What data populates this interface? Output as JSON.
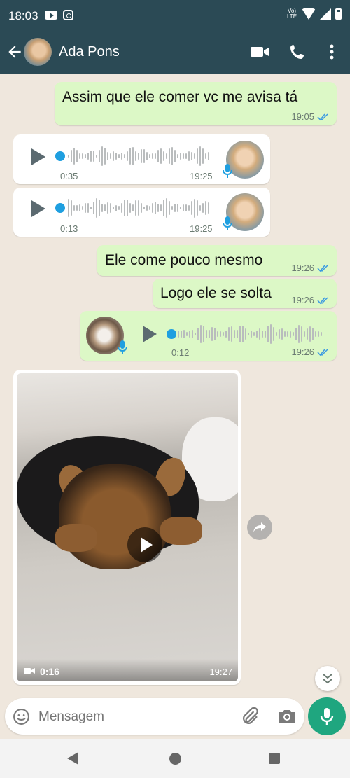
{
  "status_bar": {
    "time": "18:03",
    "network": "LTE"
  },
  "header": {
    "contact_name": "Ada Pons"
  },
  "messages": [
    {
      "type": "text",
      "direction": "out",
      "text": "Assim que ele comer vc me avisa tá",
      "time": "19:05",
      "status": "read"
    },
    {
      "type": "voice",
      "direction": "in",
      "duration": "0:35",
      "time": "19:25"
    },
    {
      "type": "voice",
      "direction": "in",
      "duration": "0:13",
      "time": "19:25"
    },
    {
      "type": "text",
      "direction": "out",
      "text": "Ele come pouco mesmo",
      "time": "19:26",
      "status": "read"
    },
    {
      "type": "text",
      "direction": "out",
      "text": "Logo ele se solta",
      "time": "19:26",
      "status": "read"
    },
    {
      "type": "voice",
      "direction": "out",
      "duration": "0:12",
      "time": "19:26",
      "status": "read"
    },
    {
      "type": "video",
      "direction": "in",
      "duration": "0:16",
      "time": "19:27"
    }
  ],
  "composer": {
    "placeholder": "Mensagem"
  },
  "colors": {
    "header": "#2b4a55",
    "outgoing_bubble": "#dcf8c6",
    "incoming_bubble": "#ffffff",
    "accent": "#1fa67f",
    "read_ticks": "#3b9ae1"
  }
}
